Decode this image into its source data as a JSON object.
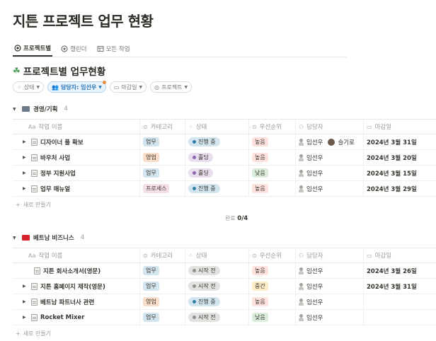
{
  "page": {
    "title": "지튼 프로젝트 업무 현황"
  },
  "tabs": [
    {
      "label": "프로젝트별",
      "icon": "target-icon",
      "active": true
    },
    {
      "label": "캘린더",
      "icon": "target-icon"
    },
    {
      "label": "모든 작업",
      "icon": "table-icon"
    }
  ],
  "database": {
    "title": "프로젝트별 업무현황",
    "icon": "clover-icon"
  },
  "filters": [
    {
      "label": "상태",
      "icon": "spinner-icon"
    },
    {
      "label": "담당자: 임선우",
      "icon": "people-icon",
      "active": true
    },
    {
      "label": "마감일",
      "icon": "calendar-icon"
    },
    {
      "label": "프로젝트",
      "icon": "target-icon"
    }
  ],
  "columns": {
    "name": "작업 이름",
    "name_prefix": "Aa",
    "category": "카테고리",
    "status": "상태",
    "priority": "우선순위",
    "owner": "담당자",
    "due": "마감일"
  },
  "groups": [
    {
      "name": "경영/기획",
      "count": "4",
      "rows": [
        {
          "name": "디자이너 풀 확보",
          "category": "업무",
          "cat_color": "blue",
          "status": "진행 중",
          "status_color": "blue",
          "priority": "높음",
          "pri_color": "red",
          "owner": "임선우",
          "owner2": "슬기로",
          "due": "2024년 3월 31일",
          "expandable": true
        },
        {
          "name": "바우처 사업",
          "category": "영업",
          "cat_color": "orange",
          "status": "홀딩",
          "status_color": "purple",
          "priority": "높음",
          "pri_color": "red",
          "owner": "임선우",
          "owner2": "",
          "due": "2024년 3월 20일",
          "expandable": true
        },
        {
          "name": "정부 지원사업",
          "category": "업무",
          "cat_color": "blue",
          "status": "홀딩",
          "status_color": "purple",
          "priority": "낮음",
          "pri_color": "green",
          "owner": "임선우",
          "owner2": "",
          "due": "2024년 3월 15일",
          "expandable": true
        },
        {
          "name": "업무 매뉴얼",
          "category": "프로세스",
          "cat_color": "pink",
          "status": "진행 중",
          "status_color": "blue",
          "priority": "높음",
          "pri_color": "red",
          "owner": "임선우",
          "owner2": "",
          "due": "2024년 3월 29일",
          "expandable": true
        }
      ],
      "new_label": "새로 만들기"
    },
    {
      "name": "베트남 비즈니스",
      "count": "4",
      "rows": [
        {
          "name": "지튼 회사소개서(영문)",
          "category": "업무",
          "cat_color": "blue",
          "status": "시작 전",
          "status_color": "gray",
          "priority": "높음",
          "pri_color": "red",
          "owner": "임선우",
          "owner2": "",
          "due": "2024년 3월 26일",
          "expandable": false
        },
        {
          "name": "지튼 홈페이지 제작(영문)",
          "category": "업무",
          "cat_color": "blue",
          "status": "시작 전",
          "status_color": "gray",
          "priority": "중간",
          "pri_color": "yellow",
          "owner": "임선우",
          "owner2": "",
          "due": "2024년 3월 31일",
          "expandable": true
        },
        {
          "name": "베트남 파트너사 관련",
          "category": "영업",
          "cat_color": "orange",
          "status": "진행 중",
          "status_color": "blue",
          "priority": "높음",
          "pri_color": "red",
          "owner": "임선우",
          "owner2": "",
          "due": "",
          "expandable": true
        },
        {
          "name": "Rocket Mixer",
          "category": "업무",
          "cat_color": "blue",
          "status": "시작 전",
          "status_color": "gray",
          "priority": "낮음",
          "pri_color": "green",
          "owner": "임선우",
          "owner2": "",
          "due": "",
          "expandable": true
        }
      ],
      "new_label": "새로 만들기"
    }
  ],
  "calc": {
    "label": "완료",
    "value": "0/4"
  }
}
